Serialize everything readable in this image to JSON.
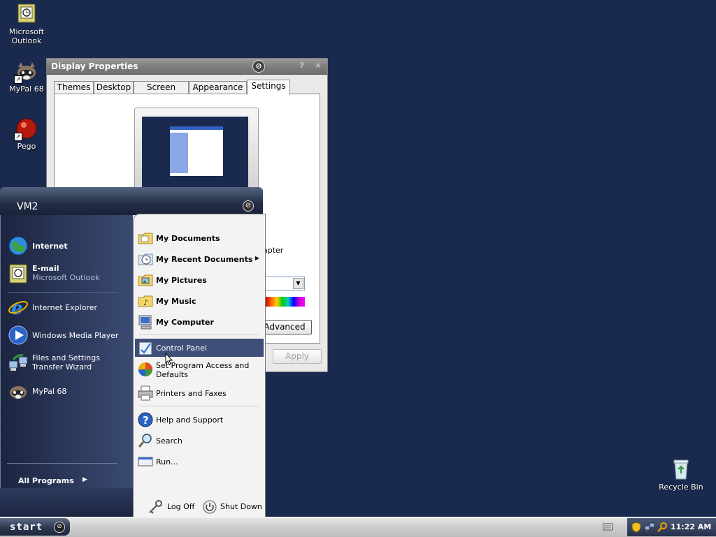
{
  "desktop": {
    "icons": [
      {
        "label": "Microsoft Outlook"
      },
      {
        "label": "MyPal 68"
      },
      {
        "label": "Pego"
      },
      {
        "label": "Recycle Bin"
      }
    ]
  },
  "display_properties": {
    "title": "Display Properties",
    "help_glyph": "?",
    "close_glyph": "×",
    "tabs": [
      {
        "label": "Themes"
      },
      {
        "label": "Desktop"
      },
      {
        "label": "Screen Saver"
      },
      {
        "label": "Appearance"
      },
      {
        "label": "Settings"
      }
    ],
    "active_tab": "Settings",
    "adapter_text": "apter",
    "advanced_label": "Advanced",
    "apply_label": "Apply"
  },
  "start_menu": {
    "user_name": "VM2",
    "pinned": [
      {
        "title": "Internet",
        "subtitle": ""
      },
      {
        "title": "E-mail",
        "subtitle": "Microsoft Outlook"
      }
    ],
    "recent": [
      {
        "title": "Internet Explorer"
      },
      {
        "title": "Windows Media Player"
      },
      {
        "title": "Files and Settings Transfer Wizard"
      },
      {
        "title": "MyPal 68"
      }
    ],
    "all_programs": "All Programs",
    "right_items": [
      {
        "label": "My Documents"
      },
      {
        "label": "My Recent Documents"
      },
      {
        "label": "My Pictures"
      },
      {
        "label": "My Music"
      },
      {
        "label": "My Computer"
      },
      {
        "label": "Control Panel"
      },
      {
        "label": "Set Program Access and Defaults"
      },
      {
        "label": "Printers and Faxes"
      },
      {
        "label": "Help and Support"
      },
      {
        "label": "Search"
      },
      {
        "label": "Run..."
      }
    ],
    "log_off": "Log Off",
    "shut_down": "Shut Down"
  },
  "taskbar": {
    "start_label": "start",
    "clock": "11:22 AM"
  },
  "colors": {
    "desktop": "#1a2a4e",
    "highlight": "#3e4f78"
  }
}
